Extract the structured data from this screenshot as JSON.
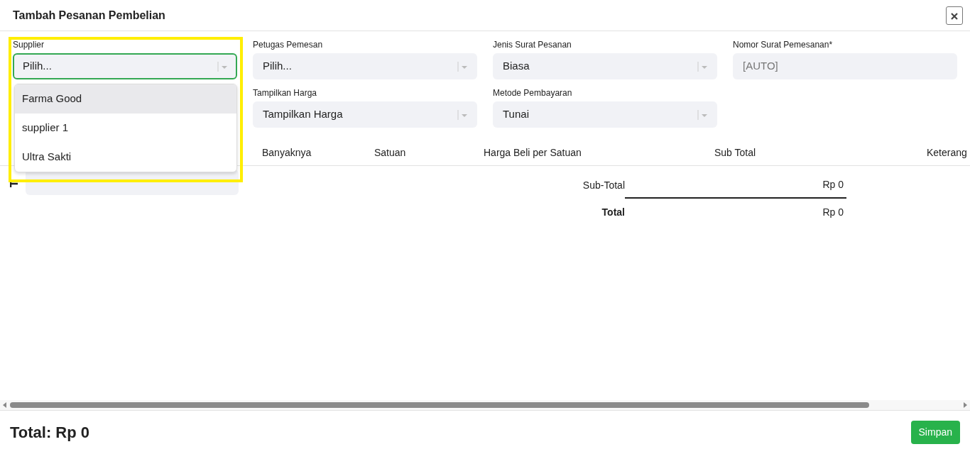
{
  "dialog": {
    "title": "Tambah Pesanan Pembelian"
  },
  "fields": [
    {
      "label": "Supplier",
      "kind": "select",
      "placeholder": "Pilih...",
      "focused": true
    },
    {
      "label": "Petugas Pemesan",
      "kind": "select",
      "placeholder": "Pilih...",
      "focused": false
    },
    {
      "label": "Jenis Surat Pesanan",
      "kind": "select",
      "value": "Biasa",
      "focused": false
    },
    {
      "label": "Nomor Surat Pemesanan*",
      "kind": "text",
      "placeholder": "[AUTO]",
      "focused": false
    },
    {
      "kind": "empty"
    },
    {
      "label": "Tampilkan Harga",
      "kind": "select",
      "value": "Tampilkan Harga",
      "focused": false
    },
    {
      "label": "Metode Pembayaran",
      "kind": "select",
      "value": "Tunai",
      "focused": false
    }
  ],
  "dropdown": {
    "options": [
      {
        "label": "Farma Good",
        "selected": true
      },
      {
        "label": "supplier 1",
        "selected": false
      },
      {
        "label": "Ultra Sakti",
        "selected": false
      }
    ]
  },
  "table": {
    "columns": [
      "Banyaknya",
      "Satuan",
      "Harga Beli per Satuan",
      "Sub Total",
      "Keterang"
    ]
  },
  "summary": [
    {
      "label": "Sub-Total",
      "value": "Rp 0",
      "bold": false
    },
    {
      "label": "Total",
      "value": "Rp 0",
      "bold": true
    }
  ],
  "footer": {
    "total": "Total: Rp 0",
    "button": "Simpan"
  }
}
